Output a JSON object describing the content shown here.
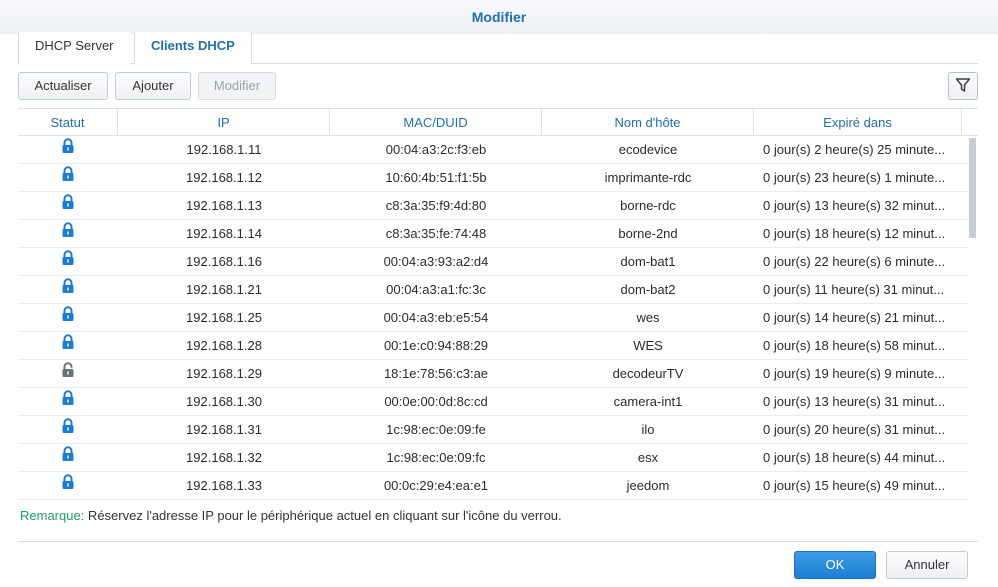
{
  "window": {
    "title": "Modifier"
  },
  "tabs": [
    {
      "label": "DHCP Server",
      "active": false
    },
    {
      "label": "Clients DHCP",
      "active": true
    }
  ],
  "toolbar": {
    "refresh_label": "Actualiser",
    "add_label": "Ajouter",
    "edit_label": "Modifier",
    "filter_icon": "filter-icon"
  },
  "table": {
    "columns": [
      "Statut",
      "IP",
      "MAC/DUID",
      "Nom d'hôte",
      "Expiré dans"
    ],
    "rows": [
      {
        "status": "reserved",
        "ip": "192.168.1.11",
        "mac": "00:04:a3:2c:f3:eb",
        "host": "ecodevice",
        "expires": "0 jour(s) 2 heure(s) 25 minute..."
      },
      {
        "status": "reserved",
        "ip": "192.168.1.12",
        "mac": "10:60:4b:51:f1:5b",
        "host": "imprimante-rdc",
        "expires": "0 jour(s) 23 heure(s) 1 minute..."
      },
      {
        "status": "reserved",
        "ip": "192.168.1.13",
        "mac": "c8:3a:35:f9:4d:80",
        "host": "borne-rdc",
        "expires": "0 jour(s) 13 heure(s) 32 minut..."
      },
      {
        "status": "reserved",
        "ip": "192.168.1.14",
        "mac": "c8:3a:35:fe:74:48",
        "host": "borne-2nd",
        "expires": "0 jour(s) 18 heure(s) 12 minut..."
      },
      {
        "status": "reserved",
        "ip": "192.168.1.16",
        "mac": "00:04:a3:93:a2:d4",
        "host": "dom-bat1",
        "expires": "0 jour(s) 22 heure(s) 6 minute..."
      },
      {
        "status": "reserved",
        "ip": "192.168.1.21",
        "mac": "00:04:a3:a1:fc:3c",
        "host": "dom-bat2",
        "expires": "0 jour(s) 11 heure(s) 31 minut..."
      },
      {
        "status": "reserved",
        "ip": "192.168.1.25",
        "mac": "00:04:a3:eb:e5:54",
        "host": "wes",
        "expires": "0 jour(s) 14 heure(s) 21 minut..."
      },
      {
        "status": "reserved",
        "ip": "192.168.1.28",
        "mac": "00:1e:c0:94:88:29",
        "host": "WES",
        "expires": "0 jour(s) 18 heure(s) 58 minut..."
      },
      {
        "status": "unreserved",
        "ip": "192.168.1.29",
        "mac": "18:1e:78:56:c3:ae",
        "host": "decodeurTV",
        "expires": "0 jour(s) 19 heure(s) 9 minute..."
      },
      {
        "status": "reserved",
        "ip": "192.168.1.30",
        "mac": "00:0e:00:0d:8c:cd",
        "host": "camera-int1",
        "expires": "0 jour(s) 13 heure(s) 31 minut..."
      },
      {
        "status": "reserved",
        "ip": "192.168.1.31",
        "mac": "1c:98:ec:0e:09:fe",
        "host": "ilo",
        "expires": "0 jour(s) 20 heure(s) 31 minut..."
      },
      {
        "status": "reserved",
        "ip": "192.168.1.32",
        "mac": "1c:98:ec:0e:09:fc",
        "host": "esx",
        "expires": "0 jour(s) 18 heure(s) 44 minut..."
      },
      {
        "status": "reserved",
        "ip": "192.168.1.33",
        "mac": "00:0c:29:e4:ea:e1",
        "host": "jeedom",
        "expires": "0 jour(s) 15 heure(s) 49 minut..."
      }
    ]
  },
  "remark": {
    "label": "Remarque:",
    "text": " Réservez l'adresse IP pour le périphérique actuel en cliquant sur l'icône du verrou."
  },
  "footer": {
    "ok_label": "OK",
    "cancel_label": "Annuler"
  },
  "colors": {
    "accent": "#1f6fb2",
    "lock_reserved": "#1a7fd4",
    "lock_unreserved": "#6b7178",
    "remark_label": "#1f9d6b",
    "primary_button": "#2a8bdc"
  },
  "icons": {
    "locked": "lock-closed-icon",
    "unlocked": "lock-open-icon"
  }
}
